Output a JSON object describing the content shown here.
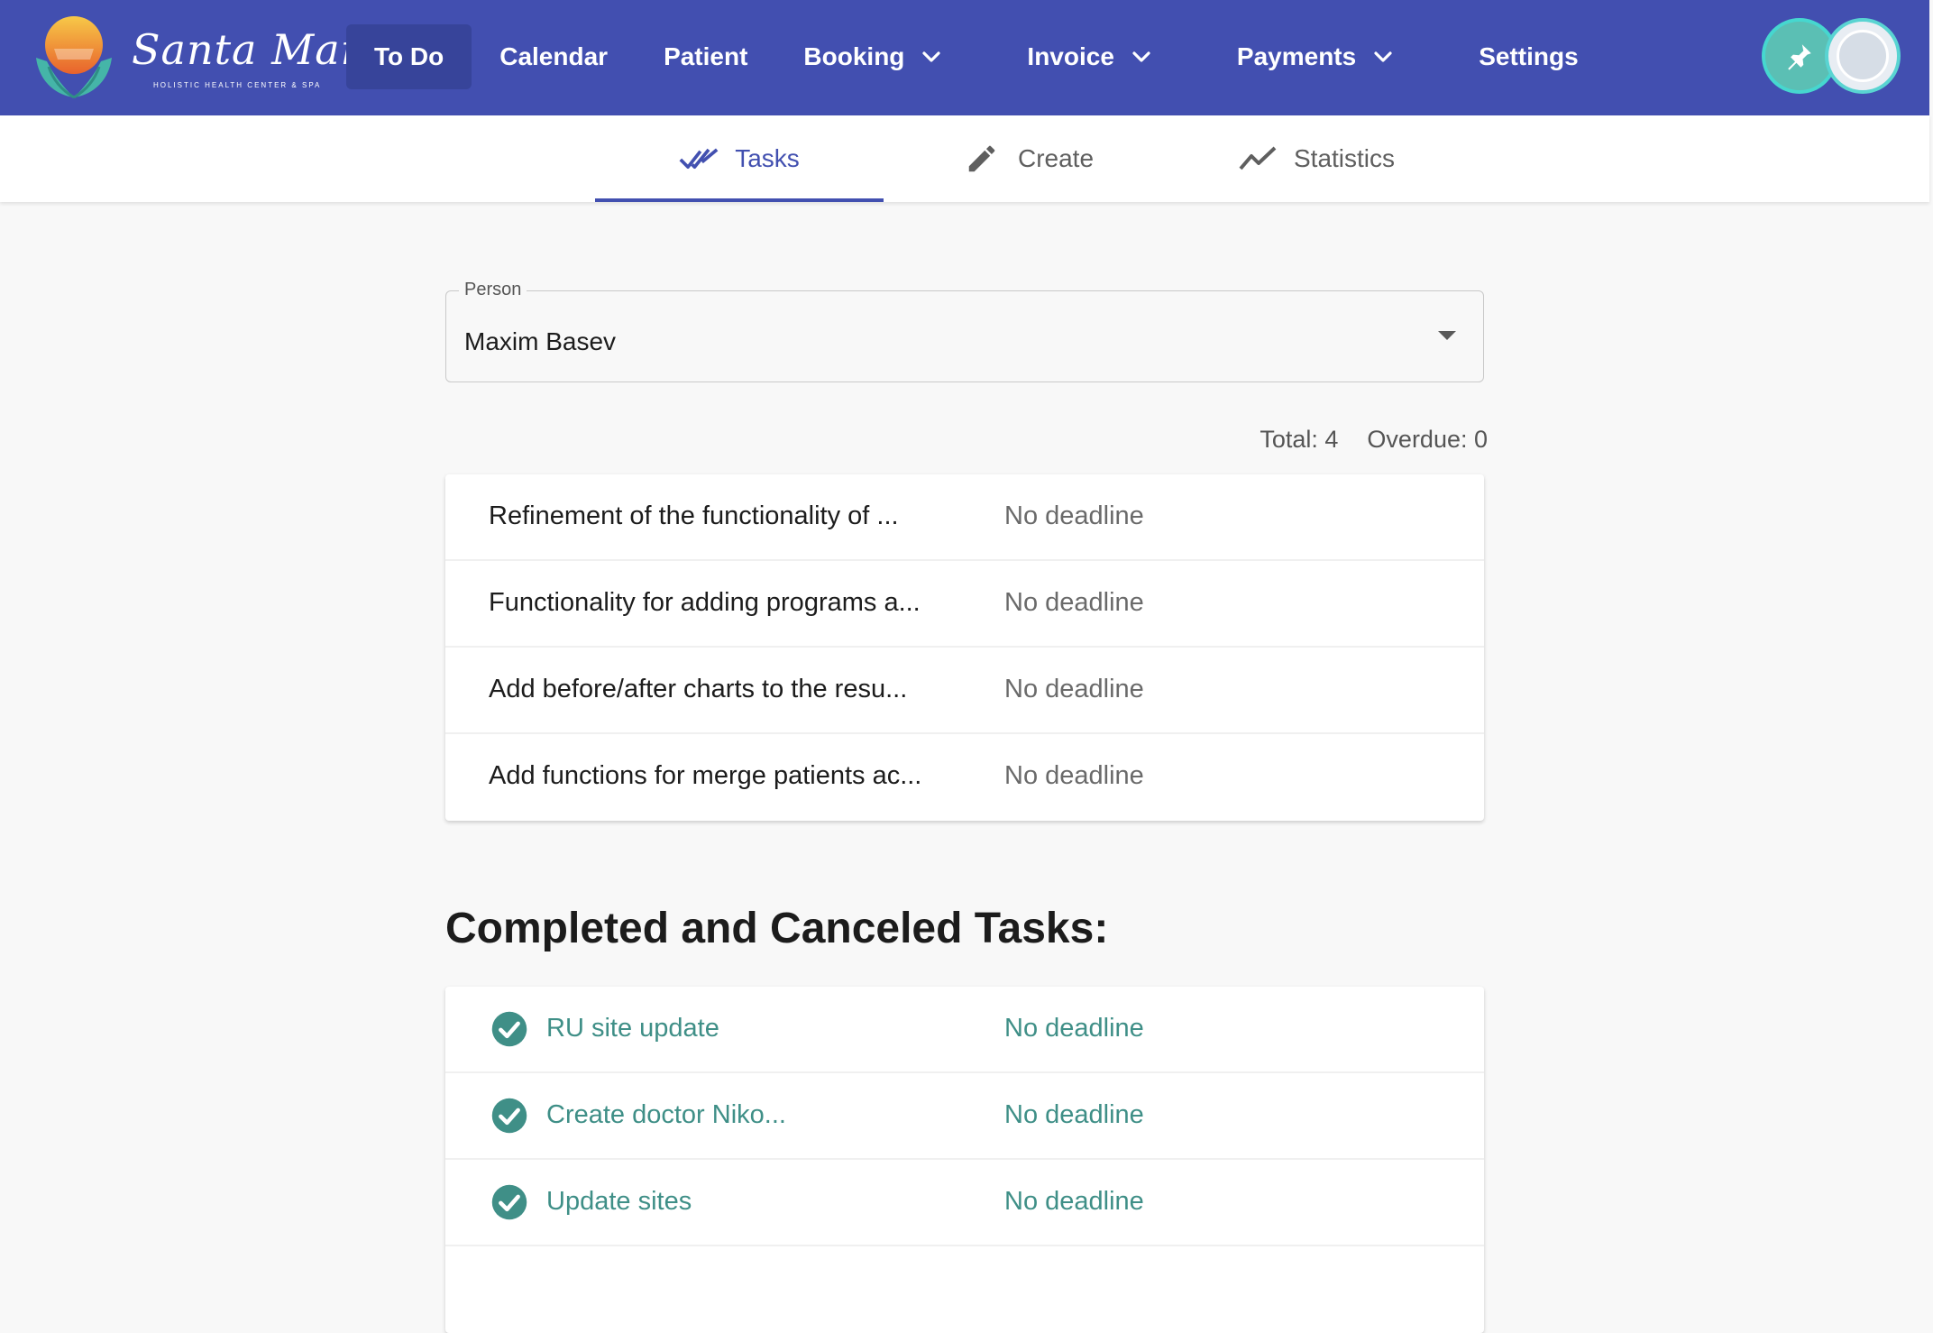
{
  "brand": {
    "name": "Santa Maria",
    "tagline": "HOLISTIC HEALTH CENTER & SPA"
  },
  "nav": {
    "items": [
      {
        "label": "To Do",
        "active": true,
        "dropdown": false
      },
      {
        "label": "Calendar",
        "active": false,
        "dropdown": false
      },
      {
        "label": "Patient",
        "active": false,
        "dropdown": false
      },
      {
        "label": "Booking",
        "active": false,
        "dropdown": true
      },
      {
        "label": "Invoice",
        "active": false,
        "dropdown": true
      },
      {
        "label": "Payments",
        "active": false,
        "dropdown": true
      },
      {
        "label": "Settings",
        "active": false,
        "dropdown": false
      }
    ]
  },
  "tabs": [
    {
      "label": "Tasks",
      "icon": "double-check-icon",
      "active": true
    },
    {
      "label": "Create",
      "icon": "pencil-icon",
      "active": false
    },
    {
      "label": "Statistics",
      "icon": "trend-line-icon",
      "active": false
    }
  ],
  "person_field": {
    "label": "Person",
    "value": "Maxim Basev"
  },
  "counts": {
    "total": "Total: 4",
    "overdue": "Overdue: 0"
  },
  "active_tasks": [
    {
      "name": "Refinement of the functionality of ...",
      "deadline": "No deadline"
    },
    {
      "name": "Functionality for adding programs a...",
      "deadline": "No deadline"
    },
    {
      "name": "Add before/after charts to the resu...",
      "deadline": "No deadline"
    },
    {
      "name": "Add functions for merge patients ac...",
      "deadline": "No deadline"
    }
  ],
  "completed_section": {
    "title": "Completed and Canceled Tasks:"
  },
  "completed_tasks": [
    {
      "name": "RU site update",
      "deadline": "No deadline"
    },
    {
      "name": "Create doctor Niko...",
      "deadline": "No deadline"
    },
    {
      "name": "Update sites",
      "deadline": "No deadline"
    }
  ],
  "colors": {
    "primary": "#424fb0",
    "nav_active": "#37449a",
    "accent_teal": "#3f8f87",
    "avatar_ring": "#46d7cf"
  }
}
